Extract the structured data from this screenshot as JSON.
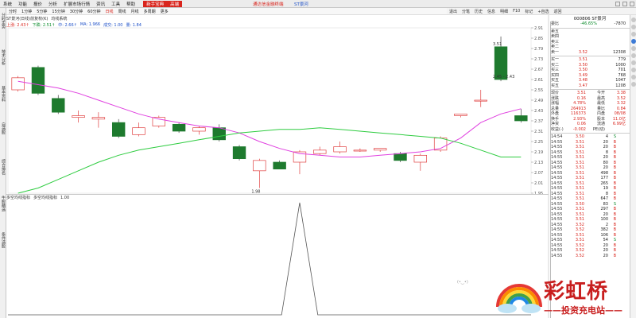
{
  "menubar": {
    "items": [
      "系统",
      "功能",
      "报价",
      "分析",
      "扩展市场行情",
      "资讯",
      "工具",
      "帮助"
    ],
    "highlight": "新手宝典",
    "highlight2": "高端",
    "center_title": "通达信金融终端",
    "center_title2": "ST景河"
  },
  "left_tabs": [
    "分时走势",
    "技术分析",
    "基本资料",
    "自选股",
    "综合排名",
    "牛股精选",
    "条件选股"
  ],
  "toolbar": {
    "items": [
      "分时",
      "1分钟",
      "5分钟",
      "15分钟",
      "30分钟",
      "60分钟",
      "日线",
      "周线",
      "月线",
      "多周期",
      "更多"
    ],
    "selected_index": 6
  },
  "indicator_row": {
    "name": "ST景河(日线)前复权(K)",
    "ma_label": "均线系统",
    "values": [
      {
        "text": "上涨: 2.43↑",
        "color": "red"
      },
      {
        "text": "下跌: 2.51↑",
        "color": "green"
      },
      {
        "text": "中: 2.66↑",
        "color": "blue"
      },
      {
        "text": "MA: 1.966",
        "color": "blue"
      },
      {
        "text": "成交: 1.00",
        "color": "blue"
      },
      {
        "text": "量: 1.84",
        "color": "blue"
      }
    ]
  },
  "lower_row": {
    "name": "多空均线指标",
    "name2": "多空均线指标",
    "value": "1.00"
  },
  "right_tools": [
    "退出",
    "分笔",
    "历史",
    "信息",
    "明细",
    "F10",
    "标记",
    "+自选",
    "返回"
  ],
  "stock_header": "000806  ST景河",
  "quote": {
    "weibi": {
      "label": "委比",
      "val": "-46.65%",
      "val2": "-7870"
    },
    "asks": [
      {
        "label": "卖五",
        "price": "",
        "vol": ""
      },
      {
        "label": "卖四",
        "price": "",
        "vol": ""
      },
      {
        "label": "卖三",
        "price": "",
        "vol": ""
      },
      {
        "label": "卖二",
        "price": "",
        "vol": ""
      },
      {
        "label": "卖一",
        "price": "3.52",
        "vol": "12308"
      }
    ],
    "bids": [
      {
        "label": "买一",
        "price": "3.51",
        "vol": "779"
      },
      {
        "label": "买二",
        "price": "3.50",
        "vol": "1000"
      },
      {
        "label": "买三",
        "price": "3.50",
        "vol": "701"
      },
      {
        "label": "买四",
        "price": "3.49",
        "vol": "768"
      },
      {
        "label": "买五",
        "price": "3.48",
        "vol": "1047"
      },
      {
        "label": "买五",
        "price": "3.47",
        "vol": "1208"
      }
    ],
    "stats": [
      {
        "l1": "现价",
        "v1": "3.51",
        "l2": "今开",
        "v2": "3.38"
      },
      {
        "l1": "涨跌",
        "v1": "0.16",
        "l2": "最高",
        "v2": "3.52"
      },
      {
        "l1": "涨幅",
        "v1": "4.78%",
        "l2": "最低",
        "v2": "3.32"
      },
      {
        "l1": "总量",
        "v1": "264913",
        "l2": "量比",
        "v2": "0.84"
      },
      {
        "l1": "外盘",
        "v1": "116373",
        "l2": "内盘",
        "v2": "08/08"
      },
      {
        "l1": "换手",
        "v1": "2.93%",
        "l2": "股本",
        "v2": "11.0亿"
      },
      {
        "l1": "净资",
        "v1": "0.06",
        "l2": "流通",
        "v2": "6.99亿"
      },
      {
        "l1": "收益(-)",
        "v1": "-0.002",
        "l2": "PE(动)",
        "v2": ""
      }
    ],
    "ticks": [
      {
        "t": "14:54",
        "p": "3.50",
        "v": "4",
        "b": "S"
      },
      {
        "t": "14:55",
        "p": "3.51",
        "v": "20",
        "b": "B"
      },
      {
        "t": "14:55",
        "p": "3.51",
        "v": "20",
        "b": "B"
      },
      {
        "t": "14:55",
        "p": "3.51",
        "v": "8",
        "b": "B"
      },
      {
        "t": "14:55",
        "p": "3.51",
        "v": "20",
        "b": "B"
      },
      {
        "t": "14:55",
        "p": "3.51",
        "v": "80",
        "b": "B"
      },
      {
        "t": "14:55",
        "p": "3.51",
        "v": "20",
        "b": "B"
      },
      {
        "t": "14:55",
        "p": "3.51",
        "v": "498",
        "b": "B"
      },
      {
        "t": "14:55",
        "p": "3.51",
        "v": "177",
        "b": "B"
      },
      {
        "t": "14:55",
        "p": "3.51",
        "v": "265",
        "b": "B"
      },
      {
        "t": "14:55",
        "p": "3.51",
        "v": "19",
        "b": "B"
      },
      {
        "t": "14:55",
        "p": "3.51",
        "v": "8",
        "b": "B"
      },
      {
        "t": "14:55",
        "p": "3.51",
        "v": "647",
        "b": "B"
      },
      {
        "t": "14:55",
        "p": "3.50",
        "v": "83",
        "b": "S"
      },
      {
        "t": "14:55",
        "p": "3.51",
        "v": "297",
        "b": "B"
      },
      {
        "t": "14:55",
        "p": "3.51",
        "v": "20",
        "b": "B"
      },
      {
        "t": "14:55",
        "p": "3.51",
        "v": "100",
        "b": "B"
      },
      {
        "t": "14:55",
        "p": "3.52",
        "v": "2",
        "b": "B"
      },
      {
        "t": "14:55",
        "p": "3.52",
        "v": "382",
        "b": "B"
      },
      {
        "t": "14:55",
        "p": "3.51",
        "v": "106",
        "b": "B"
      },
      {
        "t": "14:55",
        "p": "3.51",
        "v": "54",
        "b": "S"
      },
      {
        "t": "14:55",
        "p": "3.52",
        "v": "20",
        "b": "B"
      },
      {
        "t": "14:55",
        "p": "3.52",
        "v": "20",
        "b": "B"
      },
      {
        "t": "14:55",
        "p": "3.52",
        "v": "20",
        "b": "B"
      }
    ]
  },
  "chart_data": {
    "type": "candlestick",
    "price_axis_ticks": [
      "2.91",
      "2.85",
      "2.79",
      "2.73",
      "2.67",
      "2.61",
      "2.55",
      "2.49",
      "2.43",
      "2.37",
      "2.31",
      "2.25",
      "2.19",
      "2.13",
      "2.07",
      "2.01",
      "1.95"
    ],
    "annotations": [
      {
        "text": "3.51",
        "at_candle": 24
      },
      {
        "text": "2.45 - 2.43",
        "at_candle": 24
      },
      {
        "text": "1.98",
        "at_candle": 12
      }
    ],
    "candles": [
      {
        "o": 2.55,
        "c": 2.62,
        "h": 2.63,
        "l": 2.54,
        "up": true
      },
      {
        "o": 2.53,
        "c": 2.68,
        "h": 2.69,
        "l": 2.52,
        "up": false
      },
      {
        "o": 2.5,
        "c": 2.42,
        "h": 2.52,
        "l": 2.41,
        "up": false
      },
      {
        "o": 2.4,
        "c": 2.39,
        "h": 2.43,
        "l": 2.36,
        "up": true
      },
      {
        "o": 2.38,
        "c": 2.39,
        "h": 2.42,
        "l": 2.33,
        "up": true
      },
      {
        "o": 2.36,
        "c": 2.28,
        "h": 2.38,
        "l": 2.27,
        "up": false
      },
      {
        "o": 2.29,
        "c": 2.33,
        "h": 2.36,
        "l": 2.28,
        "up": true
      },
      {
        "o": 2.34,
        "c": 2.39,
        "h": 2.4,
        "l": 2.33,
        "up": true
      },
      {
        "o": 2.35,
        "c": 2.31,
        "h": 2.36,
        "l": 2.3,
        "up": false
      },
      {
        "o": 2.31,
        "c": 2.33,
        "h": 2.34,
        "l": 2.29,
        "up": true
      },
      {
        "o": 2.33,
        "c": 2.26,
        "h": 2.35,
        "l": 2.25,
        "up": false
      },
      {
        "o": 2.22,
        "c": 2.15,
        "h": 2.23,
        "l": 2.14,
        "up": false
      },
      {
        "o": 2.14,
        "c": 2.08,
        "h": 2.15,
        "l": 1.98,
        "up": true
      },
      {
        "o": 2.13,
        "c": 2.09,
        "h": 2.14,
        "l": 2.09,
        "up": false
      },
      {
        "o": 2.13,
        "c": 2.19,
        "h": 2.2,
        "l": 2.06,
        "up": true
      },
      {
        "o": 2.18,
        "c": 2.2,
        "h": 2.22,
        "l": 2.17,
        "up": true
      },
      {
        "o": 2.19,
        "c": 2.22,
        "h": 2.25,
        "l": 2.18,
        "up": true
      },
      {
        "o": 2.2,
        "c": 2.2,
        "h": 2.21,
        "l": 2.19,
        "up": true
      },
      {
        "o": 2.2,
        "c": 2.21,
        "h": 2.21,
        "l": 2.19,
        "up": true
      },
      {
        "o": 2.18,
        "c": 2.14,
        "h": 2.19,
        "l": 2.13,
        "up": false
      },
      {
        "o": 2.13,
        "c": 2.17,
        "h": 2.18,
        "l": 2.08,
        "up": true
      },
      {
        "o": 2.2,
        "c": 2.27,
        "h": 2.28,
        "l": 2.19,
        "up": true
      },
      {
        "o": 2.4,
        "c": 2.41,
        "h": 2.41,
        "l": 2.39,
        "up": true
      },
      {
        "o": 2.49,
        "c": 2.49,
        "h": 2.55,
        "l": 2.45,
        "up": true
      },
      {
        "o": 2.61,
        "c": 2.8,
        "h": 2.86,
        "l": 2.6,
        "up": false
      },
      {
        "o": 2.4,
        "c": 2.37,
        "h": 2.44,
        "l": 2.36,
        "up": false
      }
    ],
    "ma_short": [
      2.6,
      2.58,
      2.56,
      2.53,
      2.49,
      2.45,
      2.41,
      2.38,
      2.36,
      2.34,
      2.33,
      2.3,
      2.25,
      2.21,
      2.18,
      2.17,
      2.16,
      2.16,
      2.17,
      2.18,
      2.19,
      2.21,
      2.27,
      2.36,
      2.41,
      2.44
    ],
    "ma_long": [
      1.95,
      1.98,
      2.03,
      2.08,
      2.13,
      2.17,
      2.2,
      2.22,
      2.24,
      2.26,
      2.28,
      2.3,
      2.31,
      2.32,
      2.32,
      2.33,
      2.32,
      2.31,
      2.3,
      2.29,
      2.28,
      2.27,
      2.24,
      2.2,
      2.16,
      2.16
    ],
    "lower_indicator": {
      "peak_value": 1.0,
      "peak_at": 14
    }
  },
  "watermark": {
    "brand": "彩虹桥",
    "tagline": "——投资充电站——"
  }
}
